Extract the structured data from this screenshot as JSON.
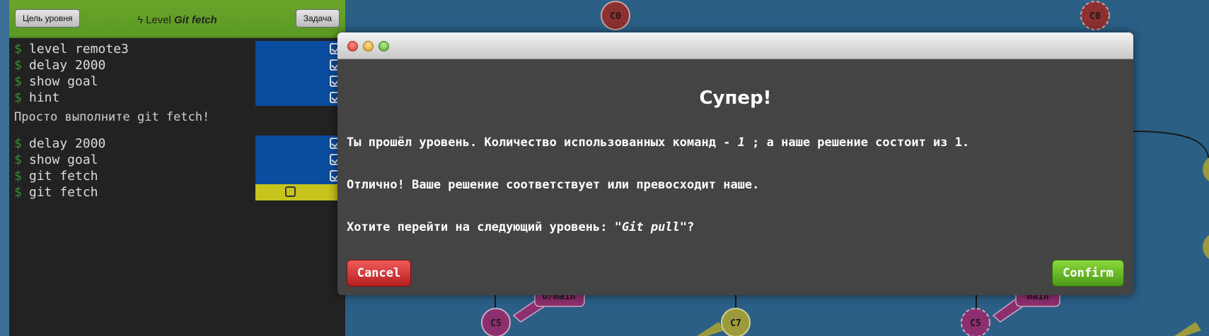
{
  "colors": {
    "canvas_bg": "#2b5f86",
    "terminal_bg": "#222222",
    "toolbar_green": "#6aa52a",
    "command_done_bg": "#0a4c9e",
    "command_pending_bg": "#c8c41e",
    "modal_bg": "#444444",
    "cancel_red": "#d13b3b",
    "confirm_green": "#6cbf2a",
    "node_red": "#8c3030",
    "node_purple": "#8c2f6e",
    "node_olive": "#9c9a3a"
  },
  "toolbar": {
    "objective_button": "Цель уровня",
    "task_button": "Задача",
    "level_prefix": "Level",
    "level_name": "Git fetch",
    "level_icon": "bolt-icon"
  },
  "terminal": {
    "prompt": "$",
    "commands_group1": [
      {
        "text": "level remote3",
        "done": true
      },
      {
        "text": "delay 2000",
        "done": true
      },
      {
        "text": "show goal",
        "done": true
      },
      {
        "text": "hint",
        "done": true
      }
    ],
    "hint_text": "Просто выполните git fetch!",
    "commands_group2": [
      {
        "text": "delay 2000",
        "done": true
      },
      {
        "text": "show goal",
        "done": true
      },
      {
        "text": "git fetch",
        "done": true
      },
      {
        "text": "git fetch",
        "done": false
      }
    ]
  },
  "canvas": {
    "nodes": [
      {
        "label": "C0",
        "color": "node_red"
      },
      {
        "label": "C0",
        "color": "node_red"
      },
      {
        "label": "C5",
        "color": "node_purple"
      },
      {
        "label": "C7",
        "color": "node_olive"
      },
      {
        "label": "C5",
        "color": "node_purple"
      }
    ],
    "branch_labels": [
      "o/main",
      "main"
    ]
  },
  "modal": {
    "window_controls": [
      "close-icon",
      "minimize-icon",
      "maximize-icon"
    ],
    "title": "Супер!",
    "line1_before": "Ты прошёл уровень. Количество использованных команд - ",
    "line1_count": "1",
    "line1_after": " ; а наше решение состоит из 1.",
    "line2": "Отлично! Ваше решение соответствует или превосходит наше.",
    "line3_before": "Хотите перейти на следующий уровень: ",
    "line3_level": "\"Git pull\"",
    "line3_after": "?",
    "cancel_label": "Cancel",
    "confirm_label": "Confirm"
  }
}
